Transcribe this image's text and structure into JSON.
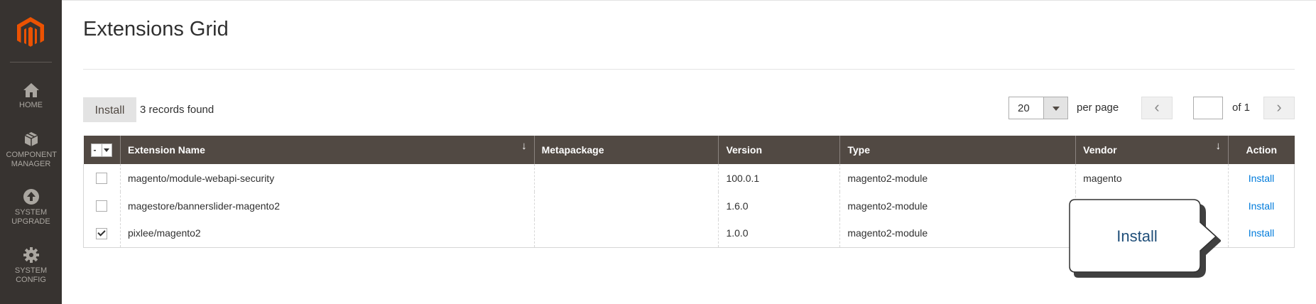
{
  "sidebar": {
    "logo": "magento-logo",
    "items": [
      {
        "icon": "home-icon",
        "label": "HOME"
      },
      {
        "icon": "component-icon",
        "label": "COMPONENT MANAGER"
      },
      {
        "icon": "upgrade-icon",
        "label": "SYSTEM UPGRADE"
      },
      {
        "icon": "gear-icon",
        "label": "SYSTEM CONFIG"
      }
    ]
  },
  "page": {
    "title": "Extensions Grid"
  },
  "toolbar": {
    "install_label": "Install",
    "records_found": "3 records found",
    "per_page_value": "20",
    "per_page_label": "per page",
    "prev_label": "‹",
    "next_label": "›",
    "page_input": "",
    "of_pages": "of 1"
  },
  "grid": {
    "mass_select": "-",
    "columns": [
      "Extension Name",
      "Metapackage",
      "Version",
      "Type",
      "Vendor",
      "Action"
    ],
    "sort_arrow": "↓",
    "rows": [
      {
        "checked": false,
        "name": "magento/module-webapi-security",
        "metapackage": "",
        "version": "100.0.1",
        "type": "magento2-module",
        "vendor": "magento",
        "action": "Install"
      },
      {
        "checked": false,
        "name": "magestore/bannerslider-magento2",
        "metapackage": "",
        "version": "1.6.0",
        "type": "magento2-module",
        "vendor": "",
        "action": "Install"
      },
      {
        "checked": true,
        "name": "pixlee/magento2",
        "metapackage": "",
        "version": "1.0.0",
        "type": "magento2-module",
        "vendor": "",
        "action": "Install"
      }
    ]
  },
  "callout": {
    "text": "Install"
  },
  "colors": {
    "sidebar": "#373330",
    "logo": "#eb5202",
    "header": "#514943",
    "link": "#007bdb"
  }
}
